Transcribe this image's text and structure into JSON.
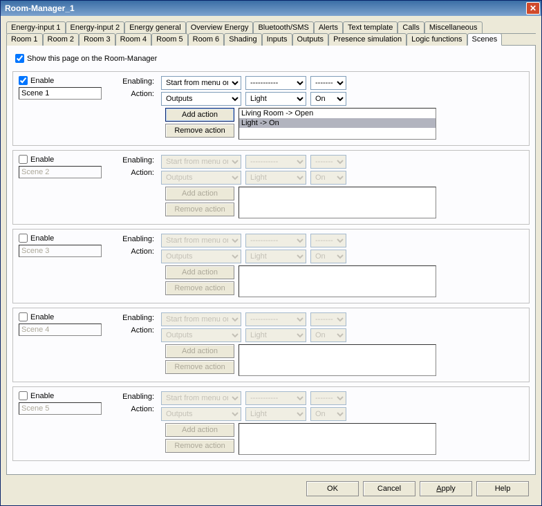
{
  "window": {
    "title": "Room-Manager_1"
  },
  "tabs_row1": [
    "Energy-input 1",
    "Energy-input 2",
    "Energy general",
    "Overview Energy",
    "Bluetooth/SMS",
    "Alerts",
    "Text template",
    "Calls",
    "Miscellaneous"
  ],
  "tabs_row2": [
    "Room 1",
    "Room 2",
    "Room 3",
    "Room 4",
    "Room 5",
    "Room 6",
    "Shading",
    "Inputs",
    "Outputs",
    "Presence simulation",
    "Logic functions",
    "Scenes"
  ],
  "active_tab": "Scenes",
  "show_page": {
    "checked": true,
    "label": "Show this page on the Room-Manager"
  },
  "labels": {
    "enable": "Enable",
    "enabling": "Enabling:",
    "action": "Action:",
    "add_action": "Add action",
    "remove_action": "Remove action",
    "dashes": "-----------"
  },
  "scenes": [
    {
      "enabled": true,
      "name": "Scene 1",
      "enabling_sel": "Start from menu on",
      "enabling_b": "-----------",
      "enabling_c": "-----------",
      "action_a": "Outputs",
      "action_b": "Light",
      "action_c": "On",
      "actions_list": [
        "Living Room -> Open",
        "Light -> On"
      ],
      "selected_list_idx": 1
    },
    {
      "enabled": false,
      "name": "Scene 2",
      "enabling_sel": "Start from menu on",
      "enabling_b": "-----------",
      "enabling_c": "-----------",
      "action_a": "Outputs",
      "action_b": "Light",
      "action_c": "On",
      "actions_list": []
    },
    {
      "enabled": false,
      "name": "Scene 3",
      "enabling_sel": "Start from menu on",
      "enabling_b": "-----------",
      "enabling_c": "-----------",
      "action_a": "Outputs",
      "action_b": "Light",
      "action_c": "On",
      "actions_list": []
    },
    {
      "enabled": false,
      "name": "Scene 4",
      "enabling_sel": "Start from menu on",
      "enabling_b": "-----------",
      "enabling_c": "-----------",
      "action_a": "Outputs",
      "action_b": "Light",
      "action_c": "On",
      "actions_list": []
    },
    {
      "enabled": false,
      "name": "Scene 5",
      "enabling_sel": "Start from menu on",
      "enabling_b": "-----------",
      "enabling_c": "-----------",
      "action_a": "Outputs",
      "action_b": "Light",
      "action_c": "On",
      "actions_list": []
    }
  ],
  "footer": {
    "ok": "OK",
    "cancel": "Cancel",
    "apply": "Apply",
    "help": "Help"
  }
}
